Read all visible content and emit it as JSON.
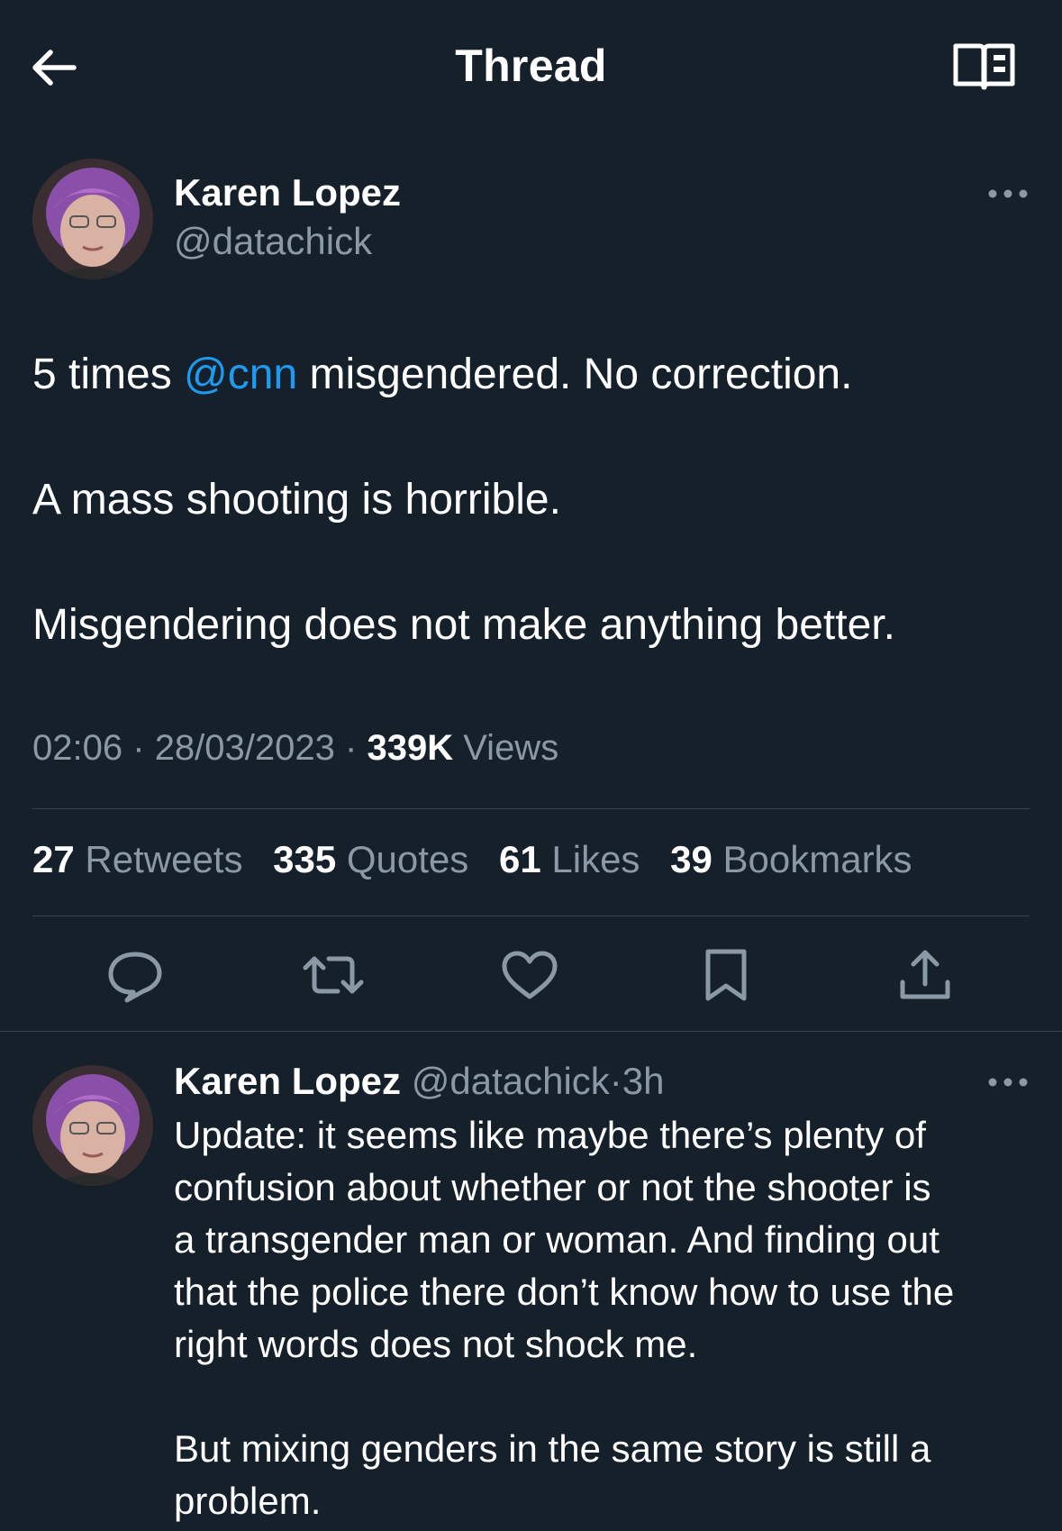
{
  "header": {
    "title": "Thread"
  },
  "main_tweet": {
    "author_name": "Karen Lopez",
    "author_handle": "@datachick",
    "text": {
      "line1_before": "5 times ",
      "line1_mention": "@cnn",
      "line1_after": " misgendered.   No correction.",
      "line2": "A mass shooting is horrible.",
      "line3": "Misgendering does not make anything better."
    },
    "time": "02:06",
    "date": "28/03/2023",
    "views_count": "339K",
    "views_label": "Views",
    "separator": "·"
  },
  "stats": [
    {
      "count": "27",
      "label": "Retweets"
    },
    {
      "count": "335",
      "label": "Quotes"
    },
    {
      "count": "61",
      "label": "Likes"
    },
    {
      "count": "39",
      "label": "Bookmarks"
    }
  ],
  "actions": [
    "reply-icon",
    "retweet-icon",
    "like-icon",
    "bookmark-icon",
    "share-icon"
  ],
  "reply": {
    "author_name": "Karen Lopez",
    "author_handle": "@datachick",
    "separator": "·",
    "time_ago": "3h",
    "lines": [
      "Update: it seems like maybe there’s plenty of",
      "confusion about whether or not the shooter is",
      "a transgender man or woman.  And finding out",
      "that the police there don’t know how to use the",
      "right words does not shock me.",
      "",
      "But mixing genders in the same story is still a",
      "problem."
    ]
  },
  "colors": {
    "background": "#15202b",
    "text": "#ffffff",
    "secondary_text": "#8b98a5",
    "link": "#1d9bf0",
    "divider": "#38444d"
  }
}
